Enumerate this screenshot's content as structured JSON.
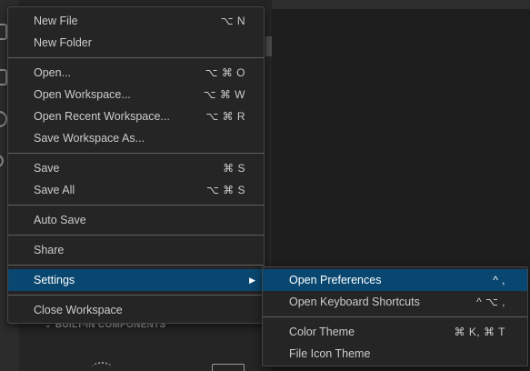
{
  "main_menu": {
    "new_file": {
      "label": "New File",
      "shortcut": "⌥ N"
    },
    "new_folder": {
      "label": "New Folder"
    },
    "open": {
      "label": "Open...",
      "shortcut": "⌥ ⌘ O"
    },
    "open_workspace": {
      "label": "Open Workspace...",
      "shortcut": "⌥ ⌘ W"
    },
    "open_recent_workspace": {
      "label": "Open Recent Workspace...",
      "shortcut": "⌥ ⌘ R"
    },
    "save_workspace_as": {
      "label": "Save Workspace As..."
    },
    "save": {
      "label": "Save",
      "shortcut": "⌘ S"
    },
    "save_all": {
      "label": "Save All",
      "shortcut": "⌥ ⌘ S"
    },
    "auto_save": {
      "label": "Auto Save"
    },
    "share": {
      "label": "Share"
    },
    "settings": {
      "label": "Settings",
      "submenu_arrow": "▶"
    },
    "close_workspace": {
      "label": "Close Workspace"
    }
  },
  "settings_submenu": {
    "open_preferences": {
      "label": "Open Preferences",
      "shortcut": "^ ,"
    },
    "open_keyboard_shortcuts": {
      "label": "Open Keyboard Shortcuts",
      "shortcut": "^ ⌥ ,"
    },
    "color_theme": {
      "label": "Color Theme",
      "shortcut": "⌘ K, ⌘ T"
    },
    "file_icon_theme": {
      "label": "File Icon Theme"
    }
  },
  "background": {
    "section_chevron": "⌄",
    "section_title": "BUILT-IN COMPONENTS"
  },
  "colors": {
    "menu_background": "#252526",
    "highlight": "#094771",
    "text": "#cccccc",
    "separator": "#606060"
  }
}
